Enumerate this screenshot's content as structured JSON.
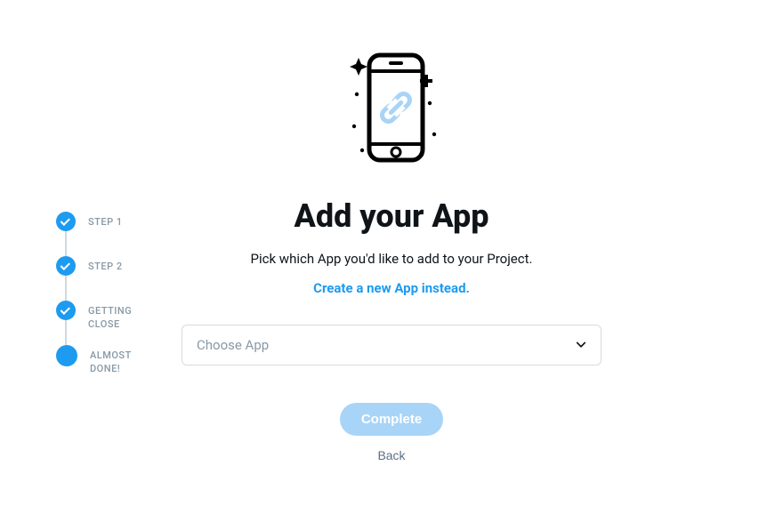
{
  "stepper": {
    "steps": [
      {
        "label": "STEP 1",
        "state": "done"
      },
      {
        "label": "STEP 2",
        "state": "done"
      },
      {
        "label": "GETTING CLOSE",
        "state": "done"
      },
      {
        "label": "ALMOST DONE!",
        "state": "current"
      }
    ]
  },
  "main": {
    "title": "Add your App",
    "subtitle": "Pick which App you'd like to add to your Project.",
    "create_link": "Create a new App instead.",
    "select_placeholder": "Choose App",
    "complete_label": "Complete",
    "back_label": "Back"
  }
}
